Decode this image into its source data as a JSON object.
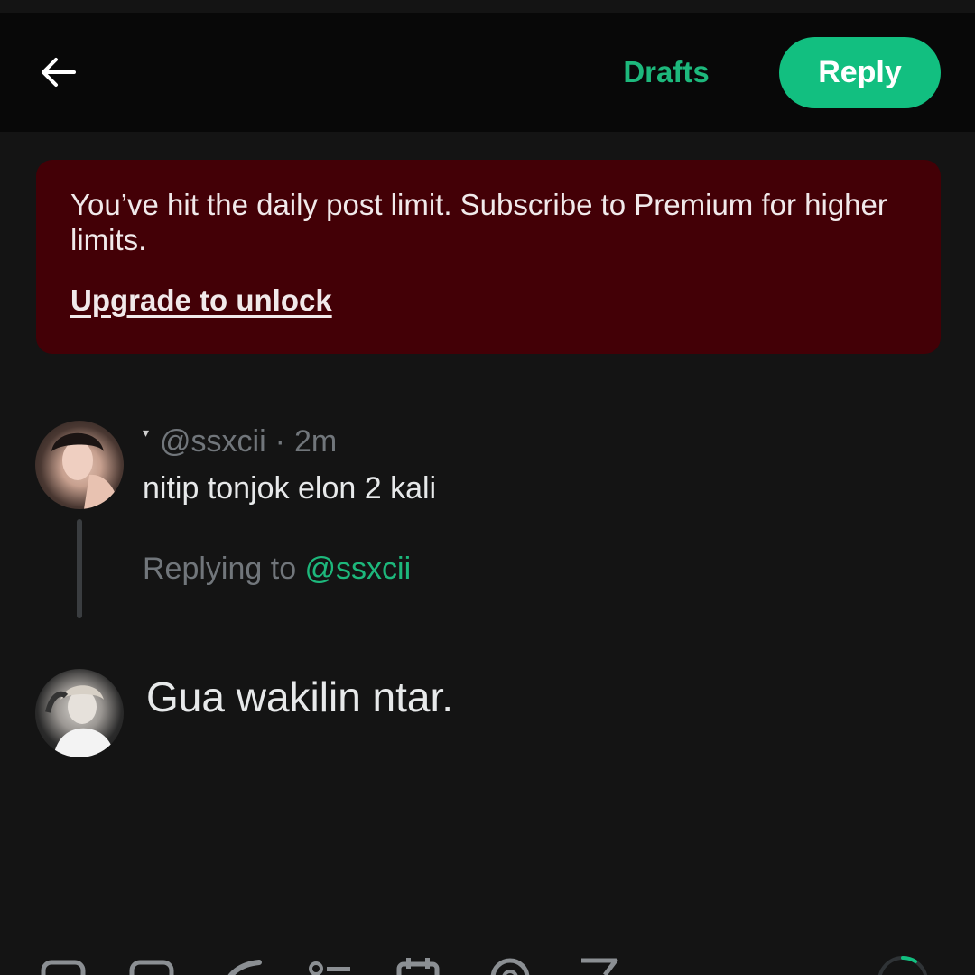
{
  "header": {
    "back_icon": "arrow-left-icon",
    "drafts_label": "Drafts",
    "reply_label": "Reply"
  },
  "banner": {
    "message": "You’ve hit the daily post limit. Subscribe to Premium for higher limits.",
    "upgrade_label": "Upgrade to unlock"
  },
  "original_post": {
    "handle": "@ssxcii",
    "separator": "·",
    "time": "2m",
    "text": "nitip tonjok elon 2 kali",
    "replying_prefix": "Replying to ",
    "replying_handle": "@ssxcii"
  },
  "composer": {
    "text": "Gua wakilin ntar."
  },
  "toolbar": {
    "icons": [
      "image-icon",
      "gif-icon",
      "grok-icon",
      "poll-icon",
      "schedule-icon",
      "location-icon",
      "flag-icon"
    ],
    "progress_icon": "character-count-ring-icon"
  },
  "colors": {
    "accent": "#12bf80",
    "accent_text": "#1db87c",
    "banner_bg": "#430006",
    "background": "#141414",
    "topbar": "#080808"
  }
}
